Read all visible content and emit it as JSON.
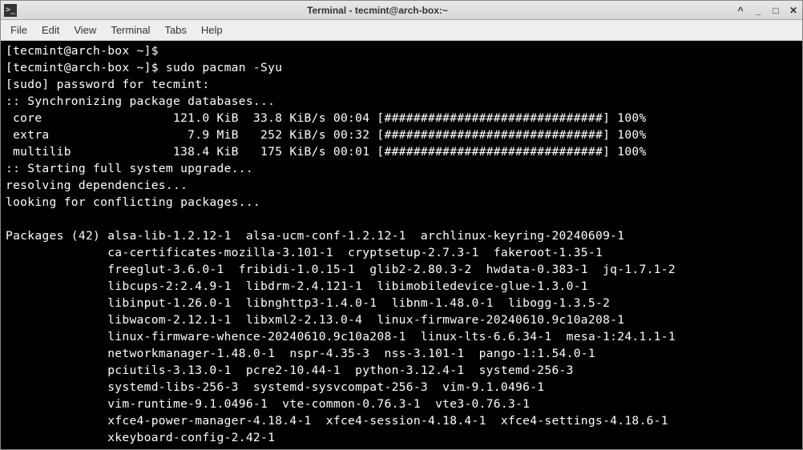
{
  "window": {
    "title": "Terminal - tecmint@arch-box:~",
    "icon_label": ">_"
  },
  "menu": {
    "file": "File",
    "edit": "Edit",
    "view": "View",
    "terminal": "Terminal",
    "tabs": "Tabs",
    "help": "Help"
  },
  "terminal": {
    "lines": [
      "[tecmint@arch-box ~]$",
      "[tecmint@arch-box ~]$ sudo pacman -Syu",
      "[sudo] password for tecmint:",
      ":: Synchronizing package databases...",
      " core                  121.0 KiB  33.8 KiB/s 00:04 [##############################] 100%",
      " extra                   7.9 MiB   252 KiB/s 00:32 [##############################] 100%",
      " multilib              138.4 KiB   175 KiB/s 00:01 [##############################] 100%",
      ":: Starting full system upgrade...",
      "resolving dependencies...",
      "looking for conflicting packages...",
      "",
      "Packages (42) alsa-lib-1.2.12-1  alsa-ucm-conf-1.2.12-1  archlinux-keyring-20240609-1",
      "              ca-certificates-mozilla-3.101-1  cryptsetup-2.7.3-1  fakeroot-1.35-1",
      "              freeglut-3.6.0-1  fribidi-1.0.15-1  glib2-2.80.3-2  hwdata-0.383-1  jq-1.7.1-2",
      "              libcups-2:2.4.9-1  libdrm-2.4.121-1  libimobiledevice-glue-1.3.0-1",
      "              libinput-1.26.0-1  libnghttp3-1.4.0-1  libnm-1.48.0-1  libogg-1.3.5-2",
      "              libwacom-2.12.1-1  libxml2-2.13.0-4  linux-firmware-20240610.9c10a208-1",
      "              linux-firmware-whence-20240610.9c10a208-1  linux-lts-6.6.34-1  mesa-1:24.1.1-1",
      "              networkmanager-1.48.0-1  nspr-4.35-3  nss-3.101-1  pango-1:1.54.0-1",
      "              pciutils-3.13.0-1  pcre2-10.44-1  python-3.12.4-1  systemd-256-3",
      "              systemd-libs-256-3  systemd-sysvcompat-256-3  vim-9.1.0496-1",
      "              vim-runtime-9.1.0496-1  vte-common-0.76.3-1  vte3-0.76.3-1",
      "              xfce4-power-manager-4.18.4-1  xfce4-session-4.18.4-1  xfce4-settings-4.18.6-1",
      "              xkeyboard-config-2.42-1"
    ]
  }
}
